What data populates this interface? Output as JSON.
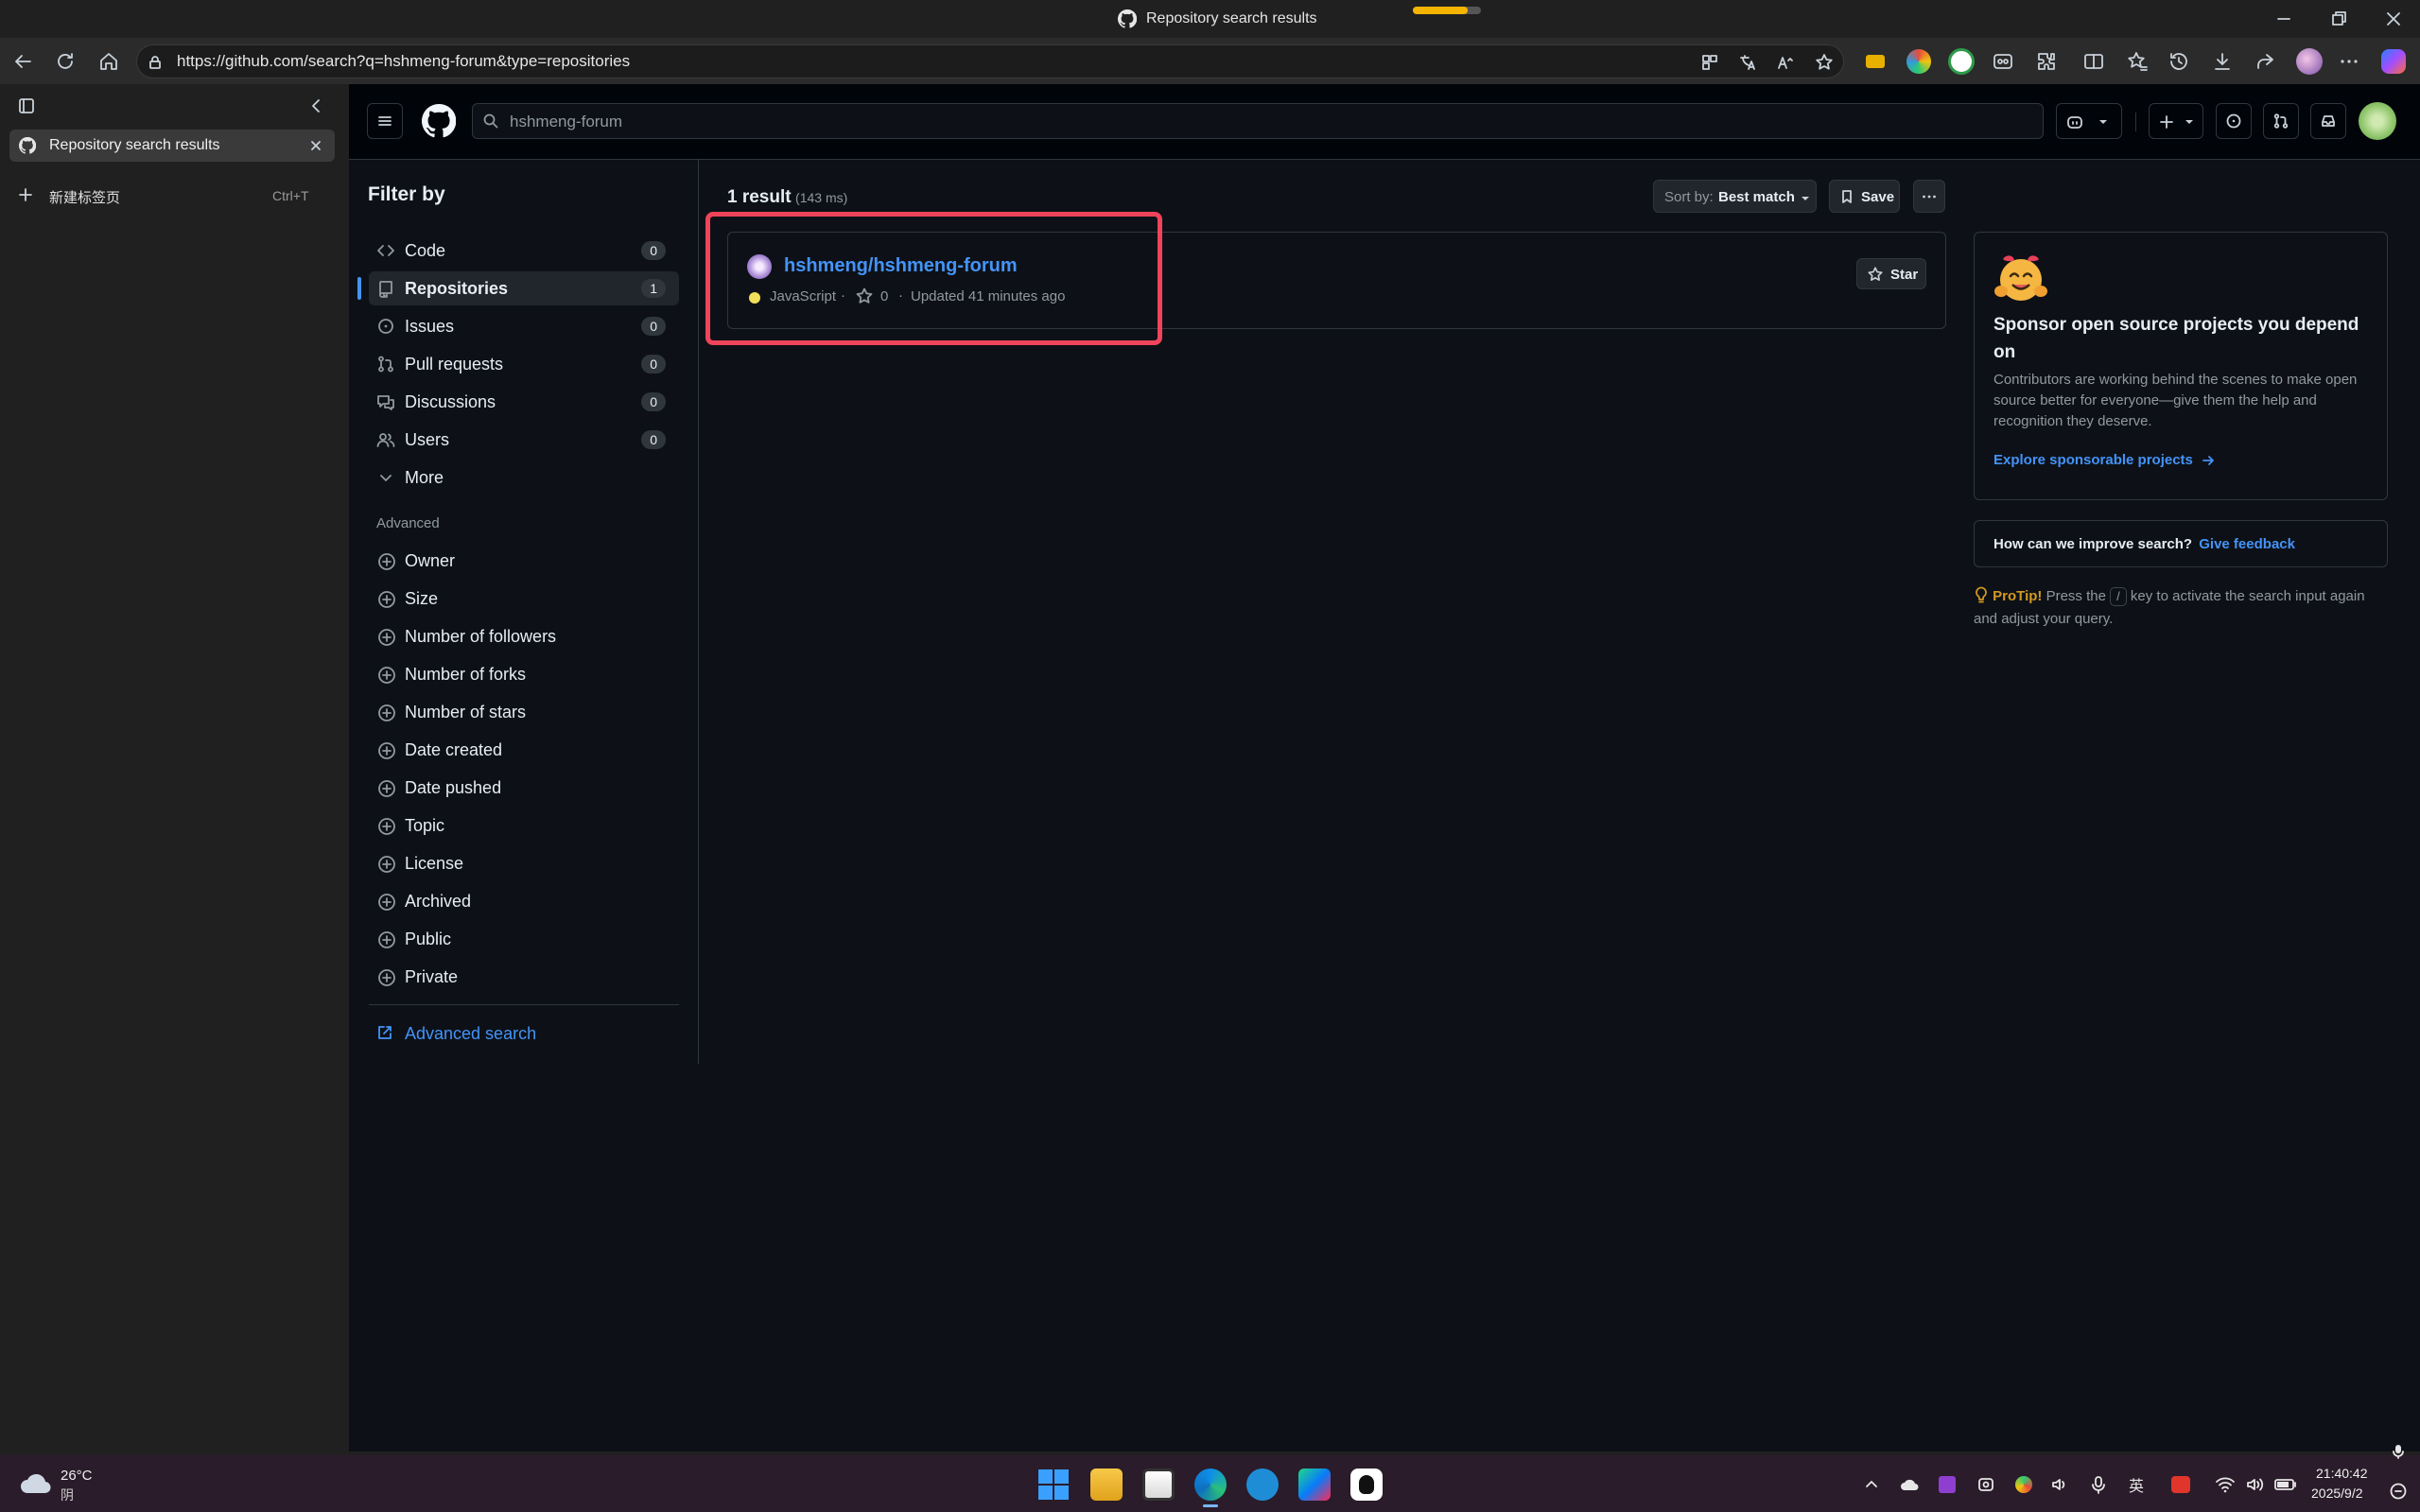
{
  "window": {
    "title": "Repository search results"
  },
  "browser": {
    "url": "https://github.com/search?q=hshmeng-forum&type=repositories",
    "tabs": [
      {
        "label": "Repository search results"
      }
    ],
    "new_tab": {
      "label": "新建标签页",
      "shortcut": "Ctrl+T"
    }
  },
  "github": {
    "search_value": "hshmeng-forum",
    "filter_title": "Filter by",
    "filters": [
      {
        "label": "Code",
        "count": "0"
      },
      {
        "label": "Repositories",
        "count": "1"
      },
      {
        "label": "Issues",
        "count": "0"
      },
      {
        "label": "Pull requests",
        "count": "0"
      },
      {
        "label": "Discussions",
        "count": "0"
      },
      {
        "label": "Users",
        "count": "0"
      }
    ],
    "more_label": "More",
    "advanced_title": "Advanced",
    "advanced": [
      "Owner",
      "Size",
      "Number of followers",
      "Number of forks",
      "Number of stars",
      "Date created",
      "Date pushed",
      "Topic",
      "License",
      "Archived",
      "Public",
      "Private"
    ],
    "advanced_search": "Advanced search",
    "results": {
      "count_label": "1 result",
      "time_label": "(143 ms)",
      "sort_prefix": "Sort by:",
      "sort_value": "Best match",
      "save_label": "Save",
      "items": [
        {
          "name": "hshmeng/hshmeng-forum",
          "language": "JavaScript",
          "stars": "0",
          "updated": "Updated 41 minutes ago",
          "star_label": "Star"
        }
      ]
    },
    "sponsor": {
      "title": "Sponsor open source projects you depend on",
      "body": "Contributors are working behind the scenes to make open source better for everyone—give them the help and recognition they deserve.",
      "link": "Explore sponsorable projects"
    },
    "feedback": {
      "question": "How can we improve search?",
      "link": "Give feedback"
    },
    "protip": {
      "label": "ProTip!",
      "pre": "Press the",
      "key": "/",
      "post": "key to activate the search input again and adjust your query."
    }
  },
  "taskbar": {
    "weather": {
      "temp": "26°C",
      "cond": "阴"
    },
    "ime": "英",
    "time": "21:40:42",
    "date": "2025/9/2"
  },
  "colors": {
    "accent": "#4493f8",
    "highlight": "#f0445a",
    "js": "#f1e05a",
    "protip": "#d29922"
  }
}
